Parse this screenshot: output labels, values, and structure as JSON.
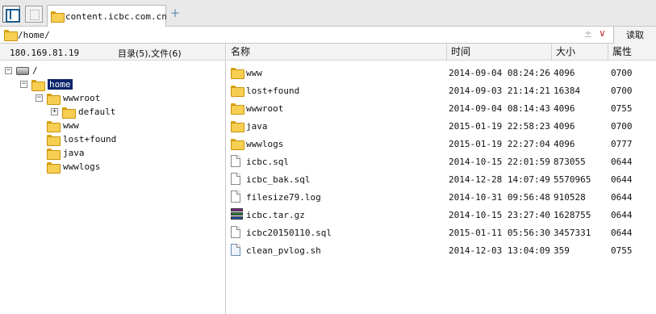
{
  "tabbar": {
    "icons": [
      "panel-toggle-icon",
      "grid-icon"
    ],
    "tab_label": "content.icbc.com.cn",
    "add_tab_symbol": "+"
  },
  "address": {
    "path": "/home/",
    "plus_symbol": "±",
    "dropdown_symbol": "∨",
    "go_label": "读取"
  },
  "left_panel": {
    "host": "180.169.81.19",
    "counts": "目录(5),文件(6)",
    "tree": [
      {
        "label": "/",
        "level": 0,
        "icon": "drive-icon",
        "expander": "⊟",
        "selected": false
      },
      {
        "label": "home",
        "level": 1,
        "icon": "folder-icon",
        "expander": "⊟",
        "selected": true
      },
      {
        "label": "wwwroot",
        "level": 2,
        "icon": "folder-icon",
        "expander": "⊟",
        "selected": false
      },
      {
        "label": "default",
        "level": 3,
        "icon": "folder-icon",
        "expander": "⊞",
        "selected": false
      },
      {
        "label": "www",
        "level": 2,
        "icon": "folder-icon",
        "expander": "",
        "selected": false
      },
      {
        "label": "lost+found",
        "level": 2,
        "icon": "folder-icon",
        "expander": "",
        "selected": false
      },
      {
        "label": "java",
        "level": 2,
        "icon": "folder-icon",
        "expander": "",
        "selected": false
      },
      {
        "label": "wwwlogs",
        "level": 2,
        "icon": "folder-icon",
        "expander": "",
        "selected": false
      }
    ]
  },
  "file_list": {
    "columns": [
      "名称",
      "时间",
      "大小",
      "属性"
    ],
    "rows": [
      {
        "name": "www",
        "time": "2014-09-04 08:24:26",
        "size": "4096",
        "attr": "0700",
        "icon": "folder-icon"
      },
      {
        "name": "lost+found",
        "time": "2014-09-03 21:14:21",
        "size": "16384",
        "attr": "0700",
        "icon": "folder-icon"
      },
      {
        "name": "wwwroot",
        "time": "2014-09-04 08:14:43",
        "size": "4096",
        "attr": "0755",
        "icon": "folder-icon"
      },
      {
        "name": "java",
        "time": "2015-01-19 22:58:23",
        "size": "4096",
        "attr": "0700",
        "icon": "folder-icon"
      },
      {
        "name": "wwwlogs",
        "time": "2015-01-19 22:27:04",
        "size": "4096",
        "attr": "0777",
        "icon": "folder-icon"
      },
      {
        "name": "icbc.sql",
        "time": "2014-10-15 22:01:59",
        "size": "873055",
        "attr": "0644",
        "icon": "file-icon"
      },
      {
        "name": "icbc_bak.sql",
        "time": "2014-12-28 14:07:49",
        "size": "5570965",
        "attr": "0644",
        "icon": "file-icon"
      },
      {
        "name": "filesize79.log",
        "time": "2014-10-31 09:56:48",
        "size": "910528",
        "attr": "0644",
        "icon": "file-icon"
      },
      {
        "name": "icbc.tar.gz",
        "time": "2014-10-15 23:27:40",
        "size": "1628755",
        "attr": "0644",
        "icon": "archive-icon"
      },
      {
        "name": "icbc20150110.sql",
        "time": "2015-01-11 05:56:30",
        "size": "3457331",
        "attr": "0644",
        "icon": "file-icon"
      },
      {
        "name": "clean_pvlog.sh",
        "time": "2014-12-03 13:04:09",
        "size": "359",
        "attr": "0755",
        "icon": "script-icon"
      }
    ]
  },
  "colors": {
    "selection_bg": "#0a246a",
    "folder_yellow": "#f6cf52",
    "header_bg": "#f3f3f3"
  }
}
